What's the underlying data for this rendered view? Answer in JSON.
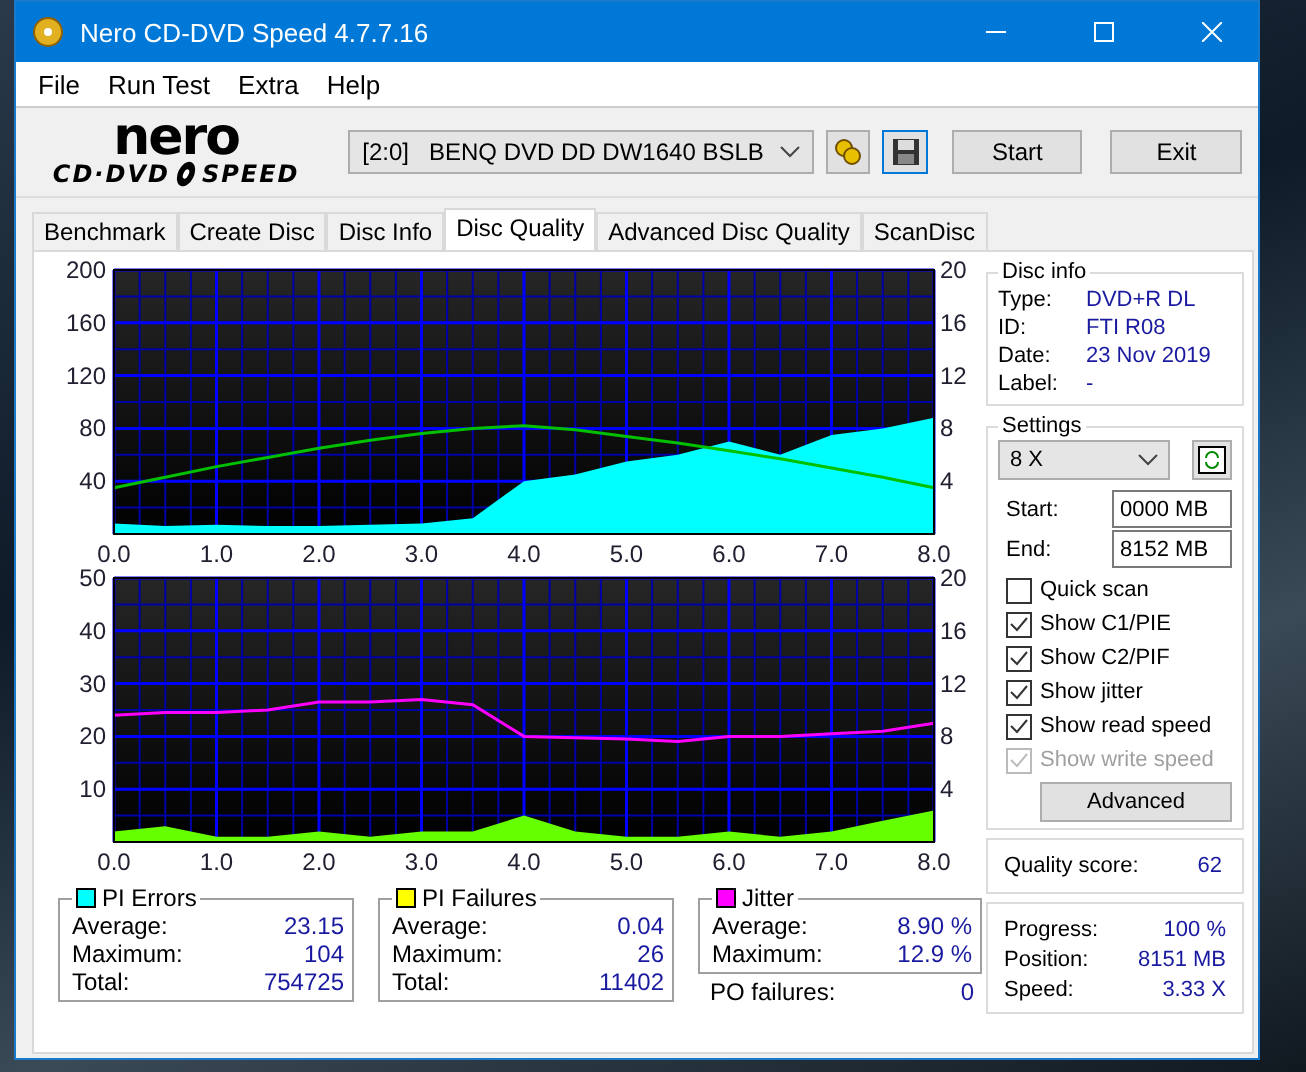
{
  "window": {
    "title": "Nero CD-DVD Speed 4.7.7.16"
  },
  "menu": [
    "File",
    "Run Test",
    "Extra",
    "Help"
  ],
  "logo": {
    "brand": "nero",
    "line1": "CD·DVD",
    "line2": "SPEED"
  },
  "toolbar": {
    "drive": "[2:0]   BENQ DVD DD DW1640 BSLB",
    "start": "Start",
    "exit": "Exit"
  },
  "tabs": [
    {
      "label": "Benchmark",
      "selected": false
    },
    {
      "label": "Create Disc",
      "selected": false
    },
    {
      "label": "Disc Info",
      "selected": false
    },
    {
      "label": "Disc Quality",
      "selected": true
    },
    {
      "label": "Advanced Disc Quality",
      "selected": false
    },
    {
      "label": "ScanDisc",
      "selected": false
    }
  ],
  "charts": [
    {
      "chart_data": {
        "type": "area",
        "grid": true,
        "xlim": [
          0,
          8
        ],
        "ylim": [
          0,
          200
        ],
        "y2lim": [
          0,
          20
        ],
        "xticks": [
          {
            "value": 0,
            "label": "0.0"
          },
          {
            "value": 1,
            "label": "1.0"
          },
          {
            "value": 2,
            "label": "2.0"
          },
          {
            "value": 3,
            "label": "3.0"
          },
          {
            "value": 4,
            "label": "4.0"
          },
          {
            "value": 5,
            "label": "5.0"
          },
          {
            "value": 6,
            "label": "6.0"
          },
          {
            "value": 7,
            "label": "7.0"
          },
          {
            "value": 8,
            "label": "8.0"
          }
        ],
        "yticks": [
          40,
          80,
          120,
          160,
          200
        ],
        "y2ticks": [
          4,
          8,
          12,
          16,
          20
        ],
        "x": [
          0,
          0.5,
          1,
          1.5,
          2,
          2.5,
          3,
          3.5,
          4,
          4.5,
          5,
          5.5,
          6,
          6.5,
          7,
          7.5,
          8
        ],
        "series": [
          {
            "color": "#00ffff",
            "values": [
              8,
              6,
              7,
              6,
              6,
              7,
              8,
              12,
              40,
              45,
              55,
              60,
              70,
              60,
              75,
              80,
              88
            ]
          },
          {
            "color": "#00c000",
            "type": "line",
            "axis": "y2",
            "values": [
              3.5,
              4.3,
              5.1,
              5.8,
              6.5,
              7.1,
              7.6,
              8,
              8.2,
              7.9,
              7.4,
              6.9,
              6.3,
              5.7,
              5,
              4.3,
              3.5
            ]
          }
        ]
      }
    },
    {
      "chart_data": {
        "type": "area",
        "grid": true,
        "xlim": [
          0,
          8
        ],
        "ylim": [
          0,
          50
        ],
        "y2lim": [
          0,
          20
        ],
        "xticks": [
          {
            "value": 0,
            "label": "0.0"
          },
          {
            "value": 1,
            "label": "1.0"
          },
          {
            "value": 2,
            "label": "2.0"
          },
          {
            "value": 3,
            "label": "3.0"
          },
          {
            "value": 4,
            "label": "4.0"
          },
          {
            "value": 5,
            "label": "5.0"
          },
          {
            "value": 6,
            "label": "6.0"
          },
          {
            "value": 7,
            "label": "7.0"
          },
          {
            "value": 8,
            "label": "8.0"
          }
        ],
        "yticks": [
          10,
          20,
          30,
          40,
          50
        ],
        "y2ticks": [
          4,
          8,
          12,
          16,
          20
        ],
        "x": [
          0,
          0.5,
          1,
          1.5,
          2,
          2.5,
          3,
          3.5,
          4,
          4.5,
          5,
          5.5,
          6,
          6.5,
          7,
          7.5,
          8
        ],
        "series": [
          {
            "color": "#66ff00",
            "values": [
              2,
              3,
              1,
              1,
              2,
              1,
              2,
              2,
              5,
              2,
              1,
              1,
              2,
              1,
              2,
              4,
              6
            ]
          },
          {
            "color": "#ff00ff",
            "type": "line",
            "axis": "y2",
            "values": [
              9.6,
              9.8,
              9.8,
              10,
              10.6,
              10.6,
              10.8,
              10.4,
              8,
              7.9,
              7.8,
              7.6,
              8,
              8,
              8.2,
              8.4,
              9
            ]
          }
        ]
      }
    }
  ],
  "stats": [
    {
      "title": "PI Errors",
      "color": "#00ffff",
      "rows": [
        {
          "label": "Average:",
          "value": "23.15"
        },
        {
          "label": "Maximum:",
          "value": "104"
        },
        {
          "label": "Total:",
          "value": "754725"
        }
      ]
    },
    {
      "title": "PI Failures",
      "color": "#ffff00",
      "rows": [
        {
          "label": "Average:",
          "value": "0.04"
        },
        {
          "label": "Maximum:",
          "value": "26"
        },
        {
          "label": "Total:",
          "value": "11402"
        }
      ]
    },
    {
      "title": "Jitter",
      "color": "#ff00ff",
      "rows": [
        {
          "label": "Average:",
          "value": "8.90 %"
        },
        {
          "label": "Maximum:",
          "value": "12.9 %"
        }
      ]
    }
  ],
  "po_failures": {
    "label": "PO failures:",
    "value": "0"
  },
  "disc_info": {
    "title": "Disc info",
    "fields": [
      {
        "label": "Type:",
        "value": "DVD+R DL"
      },
      {
        "label": "ID:",
        "value": "FTI R08"
      },
      {
        "label": "Date:",
        "value": "23 Nov 2019"
      },
      {
        "label": "Label:",
        "value": "-"
      }
    ]
  },
  "settings": {
    "title": "Settings",
    "speed": "8 X",
    "start_label": "Start:",
    "start": "0000 MB",
    "end_label": "End:",
    "end": "8152 MB",
    "options": [
      {
        "label": "Quick scan",
        "checked": false,
        "disabled": false
      },
      {
        "label": "Show C1/PIE",
        "checked": true,
        "disabled": false
      },
      {
        "label": "Show C2/PIF",
        "checked": true,
        "disabled": false
      },
      {
        "label": "Show jitter",
        "checked": true,
        "disabled": false
      },
      {
        "label": "Show read speed",
        "checked": true,
        "disabled": false
      },
      {
        "label": "Show write speed",
        "checked": true,
        "disabled": true
      }
    ],
    "advanced": "Advanced"
  },
  "quality": {
    "label": "Quality score:",
    "value": "62"
  },
  "progress": [
    {
      "label": "Progress:",
      "value": "100 %"
    },
    {
      "label": "Position:",
      "value": "8151 MB"
    },
    {
      "label": "Speed:",
      "value": "3.33 X"
    }
  ]
}
